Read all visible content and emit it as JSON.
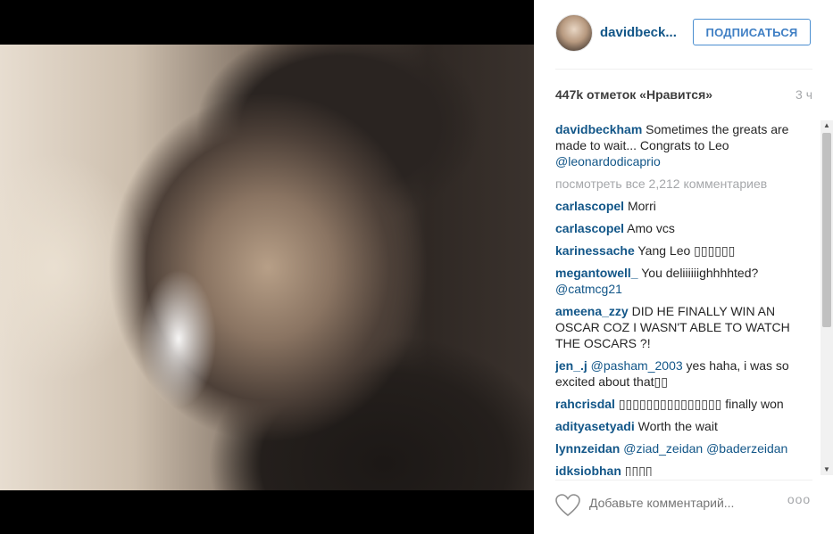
{
  "post": {
    "username": "davidbeck...",
    "follow_label": "ПОДПИСАТЬСЯ",
    "likes": "447k отметок «Нравится»",
    "time": "3 ч"
  },
  "caption": {
    "author": "davidbeckham",
    "text": " Sometimes the greats are made to wait... Congrats to Leo ",
    "mention": "@leonardodicaprio"
  },
  "view_all": "посмотреть все 2,212 комментариев",
  "comments": [
    {
      "author": "carlascopel",
      "text": " Morri"
    },
    {
      "author": "carlascopel",
      "text": " Amo vcs"
    },
    {
      "author": "karinessache",
      "text": " Yang Leo ▯▯▯▯▯▯"
    },
    {
      "author": "megantowell_",
      "text": " You deliiiiiighhhhted? ",
      "mention": "@catmcg21"
    },
    {
      "author": "ameena_zzy",
      "text": " DID HE FINALLY WIN AN OSCAR COZ I WASN'T ABLE TO WATCH THE OSCARS ?!"
    },
    {
      "author": "jen_.j",
      "mention": " @pasham_2003",
      "text": " yes haha, i was so excited about that▯▯"
    },
    {
      "author": "rahcrisdal",
      "text": " ▯▯▯▯▯▯▯▯▯▯▯▯▯▯▯ finally won"
    },
    {
      "author": "adityasetyadi",
      "text": " Worth the wait"
    },
    {
      "author": "lynnzeidan",
      "mention": " @ziad_zeidan @baderzeidan",
      "text": ""
    },
    {
      "author": "idksiobhan",
      "text": " ▯▯▯▯"
    }
  ],
  "footer": {
    "comment_placeholder": "Добавьте комментарий...",
    "more_label": "ooo"
  },
  "icons": {
    "like": "heart-icon",
    "more": "more-options-icon",
    "scroll_up": "triangle-up-icon",
    "scroll_down": "triangle-down-icon"
  },
  "colors": {
    "username": "#125688",
    "follow_border": "#4a8ed0",
    "muted": "#a5a7aa"
  }
}
